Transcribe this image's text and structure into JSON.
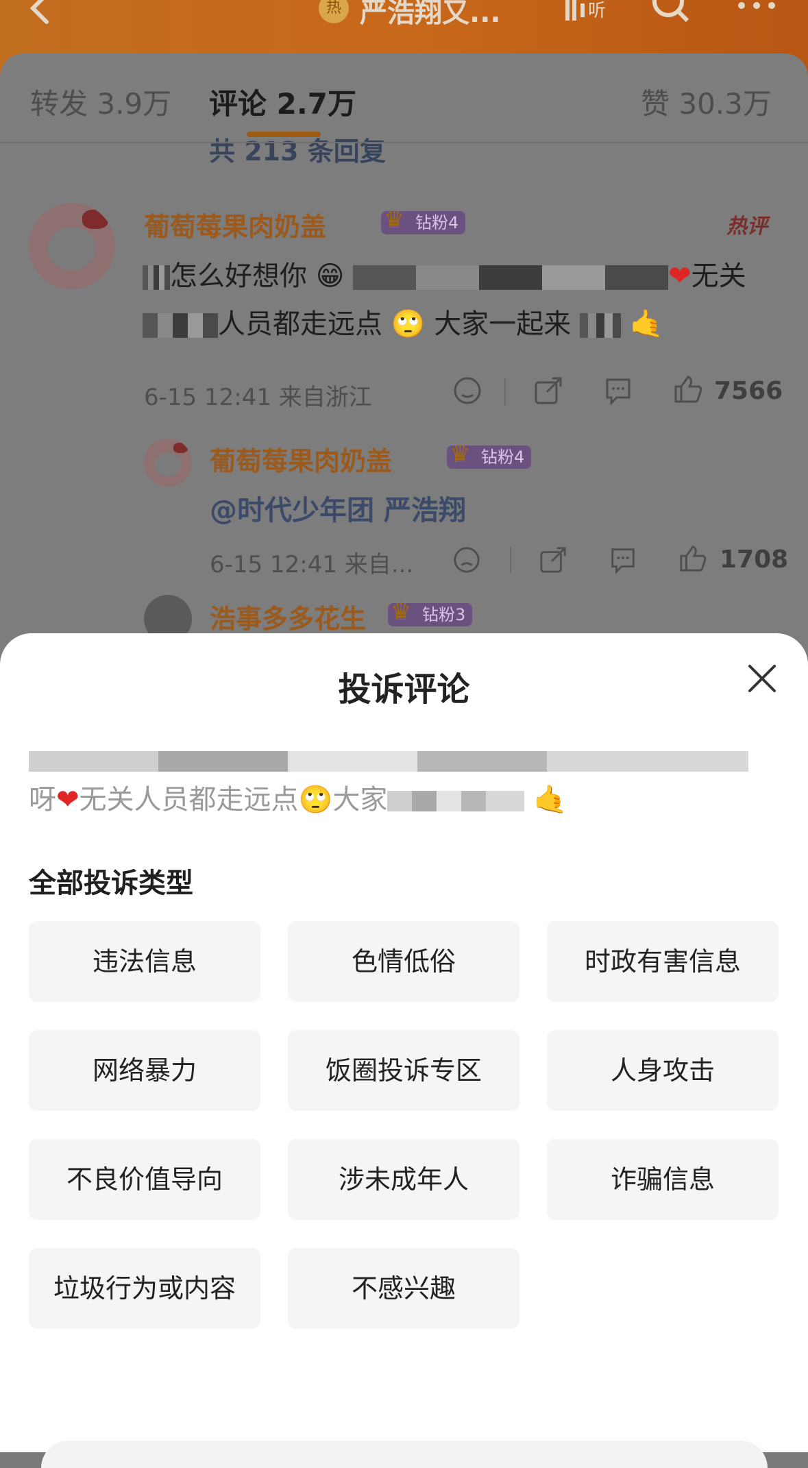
{
  "header": {
    "hot_badge": "热",
    "title": "严浩翔又...",
    "icons": [
      "back-icon",
      "listen-icon",
      "search-icon",
      "more-icon"
    ]
  },
  "tabs": {
    "repost": "转发 3.9万",
    "comment": "评论 2.7万",
    "like": "赞 30.3万"
  },
  "thread": {
    "more_replies": "共 213 条回复",
    "hot_label": "热评",
    "main_comment": {
      "username": "葡萄莓果肉奶盖",
      "fan_badge": "钻粉4",
      "line1_a": "怎么好想你",
      "line1_b": "无关",
      "line2_a": "人员都走远点",
      "line2_b": "大家一起来",
      "time_location": "6-15 12:41 来自浙江",
      "likes": "7566"
    },
    "reply": {
      "username": "葡萄莓果肉奶盖",
      "fan_badge": "钻粉4",
      "text": "@时代少年团 严浩翔",
      "time_location": "6-15 12:41 来自...",
      "likes": "1708"
    },
    "third_user": {
      "username": "浩事多多花生",
      "fan_badge": "钻粉3"
    }
  },
  "modal": {
    "title": "投诉评论",
    "quoted_line2_a": "呀",
    "quoted_line2_b": "无关人员都走远点",
    "quoted_line2_c": "大家",
    "section_label": "全部投诉类型",
    "categories": [
      "违法信息",
      "色情低俗",
      "时政有害信息",
      "网络暴力",
      "饭圈投诉专区",
      "人身攻击",
      "不良价值导向",
      "涉未成年人",
      "诈骗信息",
      "垃圾行为或内容",
      "不感兴趣"
    ]
  }
}
